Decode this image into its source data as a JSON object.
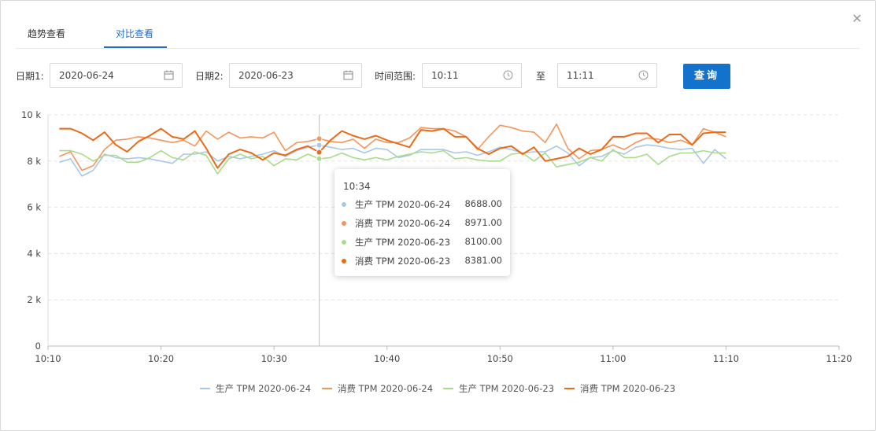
{
  "tabs": [
    {
      "label": "趋势查看",
      "active": false
    },
    {
      "label": "对比查看",
      "active": true
    }
  ],
  "filters": {
    "date1_label": "日期1:",
    "date1_value": "2020-06-24",
    "date2_label": "日期2:",
    "date2_value": "2020-06-23",
    "time_range_label": "时间范围:",
    "time_start": "10:11",
    "time_to": "至",
    "time_end": "11:11",
    "query_button": "查询"
  },
  "colors": {
    "accent": "#1f6fd1",
    "button": "#1373cc",
    "series": [
      "#a9c8e8",
      "#f5955a",
      "#a8dc8a",
      "#ec6a15"
    ]
  },
  "tooltip": {
    "time": "10:34",
    "rows": [
      {
        "name": "生产 TPM 2020-06-24",
        "value": "8688.00"
      },
      {
        "name": "消费 TPM 2020-06-24",
        "value": "8971.00"
      },
      {
        "name": "生产 TPM 2020-06-23",
        "value": "8100.00"
      },
      {
        "name": "消费 TPM 2020-06-23",
        "value": "8381.00"
      }
    ]
  },
  "legend": [
    {
      "label": "生产 TPM  2020-06-24"
    },
    {
      "label": "消费 TPM  2020-06-24"
    },
    {
      "label": "生产 TPM  2020-06-23"
    },
    {
      "label": "消费 TPM  2020-06-23"
    }
  ],
  "chart_data": {
    "type": "line",
    "x_minutes": [
      "10:11",
      "10:12",
      "10:13",
      "10:14",
      "10:15",
      "10:16",
      "10:17",
      "10:18",
      "10:19",
      "10:20",
      "10:21",
      "10:22",
      "10:23",
      "10:24",
      "10:25",
      "10:26",
      "10:27",
      "10:28",
      "10:29",
      "10:30",
      "10:31",
      "10:32",
      "10:33",
      "10:34",
      "10:35",
      "10:36",
      "10:37",
      "10:38",
      "10:39",
      "10:40",
      "10:41",
      "10:42",
      "10:43",
      "10:44",
      "10:45",
      "10:46",
      "10:47",
      "10:48",
      "10:49",
      "10:50",
      "10:51",
      "10:52",
      "10:53",
      "10:54",
      "10:55",
      "10:56",
      "10:57",
      "10:58",
      "10:59",
      "11:00",
      "11:01",
      "11:02",
      "11:03",
      "11:04",
      "11:05",
      "11:06",
      "11:07",
      "11:08",
      "11:09",
      "11:10"
    ],
    "x_ticks": [
      "10:10",
      "10:20",
      "10:30",
      "10:40",
      "10:50",
      "11:00",
      "11:10",
      "11:20"
    ],
    "y_ticks": [
      "0",
      "2 k",
      "4 k",
      "6 k",
      "8 k",
      "10 k"
    ],
    "ylim": [
      0,
      10000
    ],
    "grid": "horizontal-dashed",
    "legend_position": "bottom",
    "series": [
      {
        "name": "生产 TPM  2020-06-24",
        "values": [
          7950,
          8100,
          7350,
          7600,
          8300,
          8150,
          8100,
          8150,
          8100,
          8000,
          7900,
          8300,
          8300,
          8400,
          8000,
          8200,
          8100,
          8200,
          8300,
          8450,
          8200,
          8450,
          8600,
          8688,
          8600,
          8500,
          8550,
          8350,
          8550,
          8500,
          8150,
          8250,
          8500,
          8500,
          8500,
          8350,
          8400,
          8250,
          8400,
          8600,
          8500,
          8350,
          8400,
          8400,
          8650,
          8350,
          7800,
          8150,
          8200,
          8450,
          8300,
          8600,
          8700,
          8650,
          8550,
          8500,
          8550,
          7900,
          8500,
          8100
        ]
      },
      {
        "name": "消费 TPM  2020-06-24",
        "values": [
          8200,
          8400,
          7600,
          7800,
          8500,
          8900,
          8950,
          9050,
          9000,
          8900,
          8800,
          8900,
          8650,
          9300,
          8950,
          9250,
          9000,
          9050,
          9000,
          9250,
          8450,
          8800,
          8850,
          8971,
          8850,
          8800,
          8950,
          8550,
          8950,
          8800,
          8800,
          9000,
          9450,
          9400,
          9400,
          9300,
          9050,
          8500,
          9050,
          9550,
          9450,
          9300,
          9250,
          8800,
          9600,
          8550,
          8100,
          8450,
          8500,
          8700,
          8500,
          8800,
          9000,
          8950,
          8800,
          8900,
          8700,
          9400,
          9250,
          9050
        ]
      },
      {
        "name": "生产 TPM  2020-06-23",
        "values": [
          8450,
          8450,
          8300,
          8000,
          8250,
          8250,
          7950,
          7950,
          8150,
          8450,
          8150,
          8050,
          8400,
          8250,
          7450,
          8100,
          8300,
          8100,
          8200,
          7800,
          8100,
          8050,
          8300,
          8100,
          8150,
          8350,
          8150,
          8050,
          8150,
          8050,
          8200,
          8300,
          8400,
          8350,
          8450,
          8100,
          8150,
          8050,
          8000,
          8000,
          8300,
          8350,
          8000,
          8350,
          7750,
          7850,
          7950,
          8150,
          8000,
          8500,
          8150,
          8150,
          8300,
          7850,
          8200,
          8350,
          8350,
          8450,
          8350,
          8350
        ]
      },
      {
        "name": "消费 TPM  2020-06-23",
        "values": [
          9400,
          9400,
          9200,
          8900,
          9250,
          8700,
          8400,
          8850,
          9100,
          9400,
          9050,
          8950,
          9300,
          8550,
          7700,
          8300,
          8500,
          8350,
          8050,
          8350,
          8250,
          8500,
          8650,
          8381,
          8900,
          9300,
          9100,
          8950,
          9100,
          8900,
          8750,
          8600,
          9350,
          9300,
          9400,
          9050,
          9050,
          8550,
          8300,
          8550,
          8650,
          8300,
          8600,
          8000,
          8100,
          8200,
          8550,
          8300,
          8500,
          9050,
          9050,
          9200,
          9200,
          8800,
          9150,
          9150,
          8700,
          9200,
          9250,
          9250
        ]
      }
    ],
    "crosshair_x": "10:34"
  }
}
